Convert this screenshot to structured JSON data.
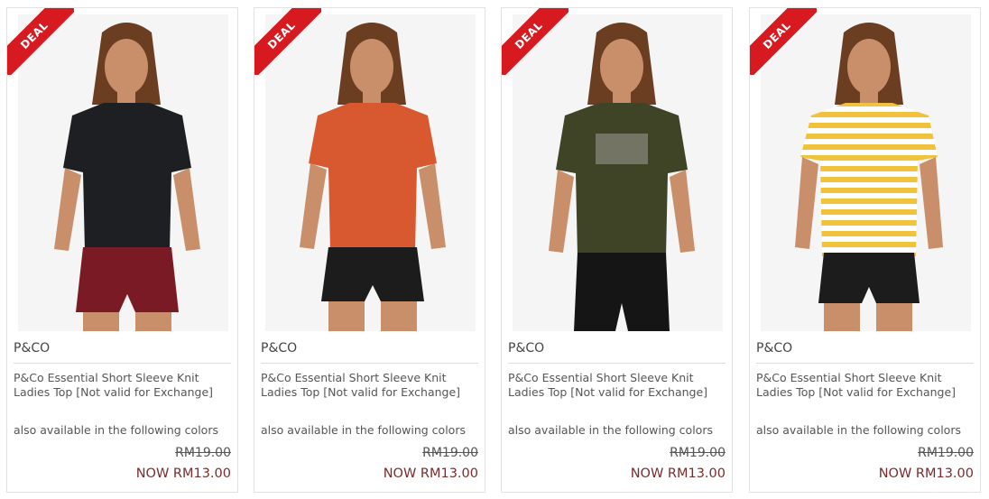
{
  "products": [
    {
      "badge": "DEAL",
      "brand": "P&CO",
      "title": "P&Co Essential Short Sleeve Knit Ladies Top [Not valid for Exchange]",
      "colors_text": "also available in the following colors",
      "original_price": "RM19.00",
      "sale_price": "NOW RM13.00",
      "shirt_color": "#1d1f22",
      "shorts_color": "#7a1a24",
      "image_name": "product-photo-black-top"
    },
    {
      "badge": "DEAL",
      "brand": "P&CO",
      "title": "P&Co Essential Short Sleeve Knit Ladies Top [Not valid for Exchange]",
      "colors_text": "also available in the following colors",
      "original_price": "RM19.00",
      "sale_price": "NOW RM13.00",
      "shirt_color": "#d8582f",
      "shorts_color": "#1c1c1c",
      "image_name": "product-photo-orange-top"
    },
    {
      "badge": "DEAL",
      "brand": "P&CO",
      "title": "P&Co Essential Short Sleeve Knit Ladies Top [Not valid for Exchange]",
      "colors_text": "also available in the following colors",
      "original_price": "RM19.00",
      "sale_price": "NOW RM13.00",
      "shirt_color": "#3f4427",
      "shorts_color": "#151515",
      "image_name": "product-photo-olive-graphic-top"
    },
    {
      "badge": "DEAL",
      "brand": "P&CO",
      "title": "P&Co Essential Short Sleeve Knit Ladies Top [Not valid for Exchange]",
      "colors_text": "also available in the following colors",
      "original_price": "RM19.00",
      "sale_price": "NOW RM13.00",
      "shirt_color": "#f1c23c",
      "shorts_color": "#1c1c1c",
      "image_name": "product-photo-yellow-stripe-top"
    }
  ],
  "accent_color": "#d71920",
  "price_color": "#7b2b2b"
}
